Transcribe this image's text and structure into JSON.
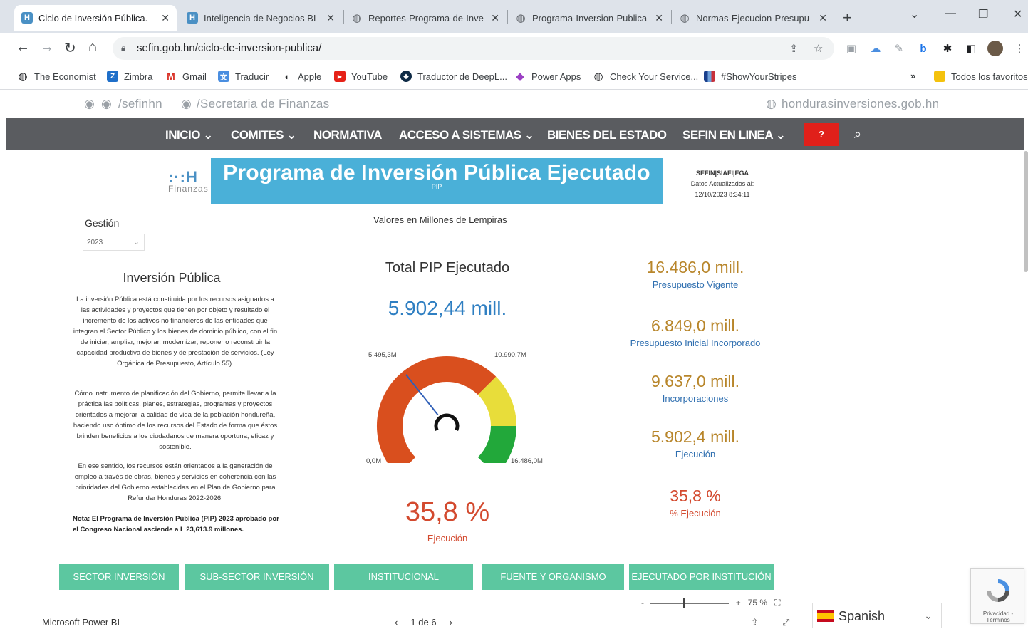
{
  "browser": {
    "tabs": [
      {
        "title": "Ciclo de Inversión Pública. –",
        "icon": "H",
        "icon_color": "#4a90c4",
        "active": true
      },
      {
        "title": "Inteligencia de Negocios BI",
        "icon": "H",
        "icon_color": "#4a90c4",
        "active": false
      },
      {
        "title": "Reportes-Programa-de-Inve",
        "icon": "globe",
        "icon_color": "#5f6368",
        "active": false
      },
      {
        "title": "Programa-Inversion-Publica",
        "icon": "globe",
        "icon_color": "#5f6368",
        "active": false
      },
      {
        "title": "Normas-Ejecucion-Presupu",
        "icon": "globe",
        "icon_color": "#5f6368",
        "active": false
      }
    ],
    "url": "sefin.gob.hn/ciclo-de-inversion-publica/",
    "bookmarks": [
      {
        "label": "The Economist",
        "icon": "globe"
      },
      {
        "label": "Zimbra",
        "icon": "Z"
      },
      {
        "label": "Gmail",
        "icon": "M"
      },
      {
        "label": "Traducir",
        "icon": "translate"
      },
      {
        "label": "Apple",
        "icon": "apple"
      },
      {
        "label": "YouTube",
        "icon": "youtube"
      },
      {
        "label": "Traductor de DeepL...",
        "icon": "deepl"
      },
      {
        "label": "Power Apps",
        "icon": "powerapps"
      },
      {
        "label": "Check Your Service...",
        "icon": "globe"
      },
      {
        "label": "#ShowYourStripes",
        "icon": "stripes"
      }
    ],
    "more_bookmarks": "»",
    "all_bookmarks": "Todos los favoritos"
  },
  "site": {
    "social_left_1": "/sefinhn",
    "social_left_2": "/Secretaria de Finanzas",
    "social_right": "hondurasinversiones.gob.hn",
    "menu": [
      "INICIO",
      "COMITES",
      "NORMATIVA",
      "ACCESO A SISTEMAS",
      "BIENES DEL ESTADO",
      "SEFIN EN LINEA"
    ],
    "help_label": "?"
  },
  "report": {
    "logo_mark": ":·:H",
    "logo_text": "Finanzas",
    "banner_title": "Programa de Inversión Pública Ejecutado",
    "banner_sub": "PIP",
    "meta_line1": "SEFIN|SIAFI|EGA",
    "meta_line2": "Datos Actualizados al:",
    "meta_line3": "12/10/2023 8:34:11",
    "units": "Valores en Millones de Lempiras",
    "gestion_label": "Gestión",
    "gestion_value": "2023",
    "inv_title": "Inversión Pública",
    "inv_p1": "La inversión Pública está constituida por los recursos asignados a las actividades y proyectos que tienen por objeto y resultado el incremento de los activos no financieros de las entidades que integran el Sector Público y los bienes de dominio público, con el fin de iniciar, ampliar, mejorar, modernizar, reponer o reconstruir la capacidad productiva de bienes y de prestación de servicios. (Ley Orgánica de Presupuesto, Artículo 55).",
    "inv_p2": "Cómo instrumento de planificación del Gobierno, permite llevar a la práctica las políticas, planes, estrategias, programas y proyectos orientados a mejorar la calidad de vida de la población hondureña, haciendo uso óptimo de los recursos del Estado de forma que éstos brinden beneficios a los ciudadanos de manera oportuna, eficaz y sostenible.",
    "inv_p3": "En ese sentido, los recursos están orientados a la generación de empleo a través de obras, bienes y servicios en coherencia con las prioridades del Gobierno establecidas en el Plan de Gobierno para Refundar Honduras 2022-2026.",
    "nota": "Nota: El Programa de Inversión Pública (PIP) 2023 aprobado por el Congreso Nacional asciende a L 23,613.9 millones.",
    "gauge_title": "Total PIP Ejecutado",
    "gauge_total": "5.902,44 mill.",
    "gauge_pct": "35,8 %",
    "gauge_pct_label": "Ejecución",
    "kpis": [
      {
        "value": "16.486,0 mill.",
        "label": "Presupuesto Vigente",
        "value_color": "#b8862b",
        "label_color": "#2f6fb0"
      },
      {
        "value": "6.849,0 mill.",
        "label": "Presupuesto Inicial Incorporado",
        "value_color": "#b8862b",
        "label_color": "#2f6fb0"
      },
      {
        "value": "9.637,0 mill.",
        "label": "Incorporaciones",
        "value_color": "#b8862b",
        "label_color": "#2f6fb0"
      },
      {
        "value": "5.902,4 mill.",
        "label": "Ejecución",
        "value_color": "#b8862b",
        "label_color": "#2f6fb0"
      },
      {
        "value": "35,8 %",
        "label": "% Ejecución",
        "value_color": "#d34a2f",
        "label_color": "#d34a2f"
      }
    ],
    "nav_tabs": [
      "SECTOR INVERSIÓN",
      "SUB-SECTOR INVERSIÓN",
      "INSTITUCIONAL",
      "FUENTE Y ORGANISMO",
      "EJECUTADO POR INSTITUCIÓN"
    ],
    "zoom_label": "75 %",
    "pbi_brand": "Microsoft Power BI",
    "pager": "1 de 6"
  },
  "chart_data": {
    "type": "gauge",
    "title": "Total PIP Ejecutado",
    "min": 0.0,
    "max": 16486.0,
    "value": 5902.44,
    "bands": [
      {
        "from": 0.0,
        "to": 10990.7,
        "color": "#d94f1e"
      },
      {
        "from": 10990.7,
        "to": 13738.0,
        "color": "#e8dd3a"
      },
      {
        "from": 13738.0,
        "to": 16486.0,
        "color": "#22a83a"
      }
    ],
    "labels": {
      "min": "0,0M",
      "mid": "5.495,3M",
      "upper": "10.990,7M",
      "max": "16.486,0M"
    },
    "needle_color": "#2f5fb8"
  },
  "language": {
    "value": "Spanish"
  },
  "recaptcha": {
    "text": "Privacidad - Términos"
  }
}
